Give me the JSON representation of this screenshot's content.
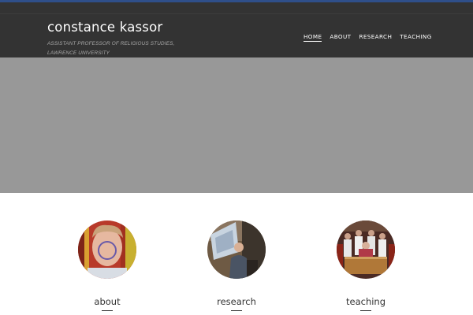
{
  "site": {
    "title": "constance kassor",
    "tagline": "ASSISTANT PROFESSOR OF RELIGIOUS STUDIES, LAWRENCE UNIVERSITY"
  },
  "nav": {
    "items": [
      {
        "label": "HOME",
        "active": true
      },
      {
        "label": "ABOUT",
        "active": false
      },
      {
        "label": "RESEARCH",
        "active": false
      },
      {
        "label": "TEACHING",
        "active": false
      }
    ]
  },
  "features": [
    {
      "label": "about",
      "image": "portrait-photo"
    },
    {
      "label": "research",
      "image": "lecture-photo"
    },
    {
      "label": "teaching",
      "image": "group-photo"
    }
  ],
  "colors": {
    "top_accent": "#2f4f8a",
    "header_bg": "#333333",
    "hero_bg": "#989898"
  }
}
